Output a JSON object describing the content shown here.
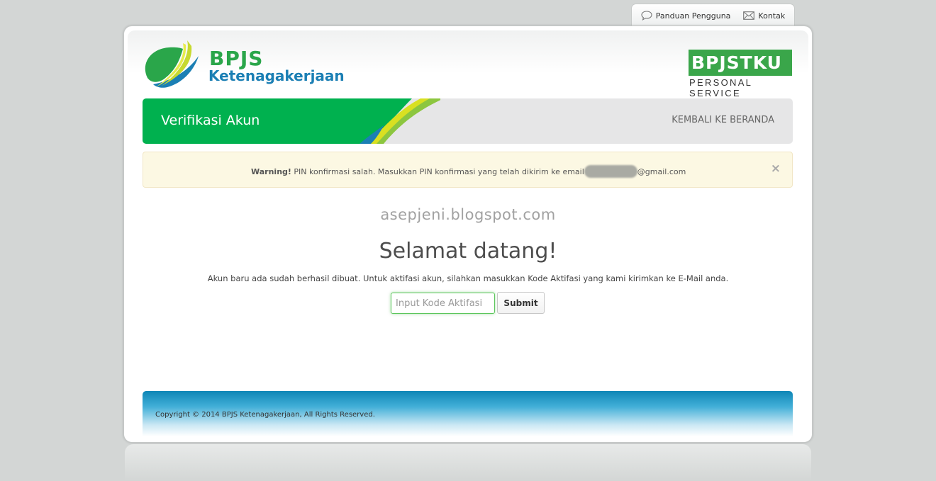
{
  "top_nav": {
    "guide_label": "Panduan Pengguna",
    "contact_label": "Kontak"
  },
  "logo_left": {
    "line1": "BPJS",
    "line2": "Ketenagakerjaan"
  },
  "logo_right": {
    "brand": "BPJSTKU",
    "subtitle": "PERSONAL SERVICE"
  },
  "header": {
    "title": "Verifikasi Akun",
    "back_link": "KEMBALI KE BERANDA"
  },
  "alert": {
    "strong": "Warning!",
    "message": "PIN konfirmasi salah. Masukkan PIN konfirmasi yang telah dikirim ke email",
    "email_suffix": "@gmail.com",
    "close_symbol": "×"
  },
  "watermark": "asepjeni.blogspot.com",
  "main": {
    "heading": "Selamat datang!",
    "description": "Akun baru ada sudah berhasil dibuat. Untuk aktifasi akun, silahkan masukkan Kode Aktifasi yang kami kirimkan ke E-Mail anda.",
    "input_placeholder": "Input Kode Aktifasi",
    "input_value": "",
    "submit_label": "Submit"
  },
  "footer": {
    "copyright": "Copyright © 2014 BPJS Ketenagakerjaan, All Rights Reserved."
  },
  "colors": {
    "green": "#00b14f",
    "bpjs_blue": "#1b7fb4",
    "alert_bg": "#fcf8e3",
    "footer_blue": "#0e86b6"
  },
  "icons": {
    "guide": "speech-bubble-icon",
    "contact": "envelope-icon",
    "close": "close-icon"
  }
}
